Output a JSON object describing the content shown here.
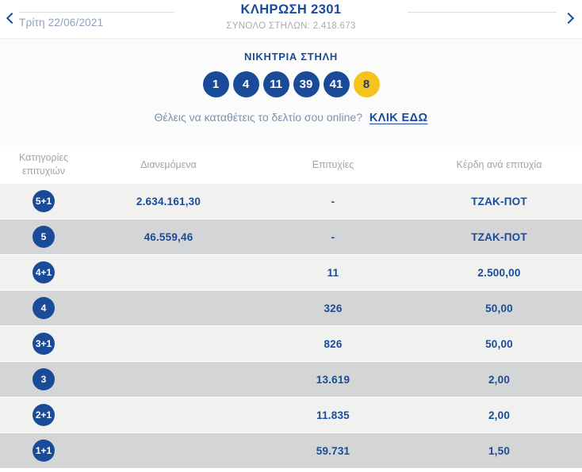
{
  "header": {
    "date": "Τρίτη 22/06/2021",
    "title": "ΚΛΗΡΩΣΗ 2301",
    "subtitle": "ΣΥΝΟΛΟ ΣΤΗΛΩΝ: 2.418.673"
  },
  "winning": {
    "title": "ΝΙΚΗΤΡΙΑ ΣΤΗΛΗ",
    "numbers": [
      "1",
      "4",
      "11",
      "39",
      "41"
    ],
    "joker": "8",
    "question": "Θέλεις να καταθέτεις το δελτίο σου online?",
    "link_label": "ΚΛΙΚ ΕΔΩ"
  },
  "table": {
    "headers": {
      "category_line1": "Κατηγορίες",
      "category_line2": "επιτυχιών",
      "distributed": "Διανεμόμενα",
      "winners": "Επιτυχίες",
      "prize": "Κέρδη ανά επιτυχία"
    },
    "rows": [
      {
        "category": "5+1",
        "distributed": "2.634.161,30",
        "winners": "-",
        "prize": "ΤΖΑΚ-ΠΟΤ"
      },
      {
        "category": "5",
        "distributed": "46.559,46",
        "winners": "-",
        "prize": "ΤΖΑΚ-ΠΟΤ"
      },
      {
        "category": "4+1",
        "distributed": "",
        "winners": "11",
        "prize": "2.500,00"
      },
      {
        "category": "4",
        "distributed": "",
        "winners": "326",
        "prize": "50,00"
      },
      {
        "category": "3+1",
        "distributed": "",
        "winners": "826",
        "prize": "50,00"
      },
      {
        "category": "3",
        "distributed": "",
        "winners": "13.619",
        "prize": "2,00"
      },
      {
        "category": "2+1",
        "distributed": "",
        "winners": "11.835",
        "prize": "2,00"
      },
      {
        "category": "1+1",
        "distributed": "",
        "winners": "59.731",
        "prize": "1,50"
      }
    ]
  },
  "icons": {
    "prev": "chevron-left-icon",
    "next": "chevron-right-icon"
  },
  "colors": {
    "accent_blue": "#1a4b99",
    "joker_yellow": "#f5c41c",
    "row_light": "#f1f1f0",
    "row_dark": "#d3d5d6"
  }
}
